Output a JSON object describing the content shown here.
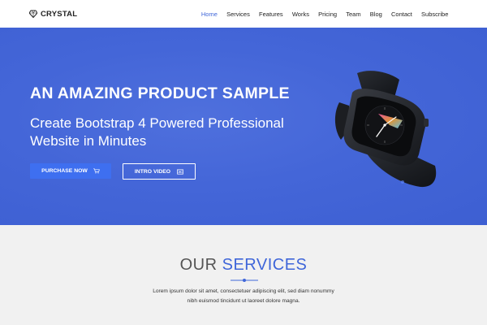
{
  "brand": {
    "name": "CRYSTAL",
    "icon": "diamond-icon"
  },
  "nav": {
    "items": [
      {
        "label": "Home",
        "active": true
      },
      {
        "label": "Services",
        "active": false
      },
      {
        "label": "Features",
        "active": false
      },
      {
        "label": "Works",
        "active": false
      },
      {
        "label": "Pricing",
        "active": false
      },
      {
        "label": "Team",
        "active": false
      },
      {
        "label": "Blog",
        "active": false
      },
      {
        "label": "Contact",
        "active": false
      },
      {
        "label": "Subscribe",
        "active": false
      }
    ]
  },
  "hero": {
    "title": "AN AMAZING PRODUCT SAMPLE",
    "subtitle": "Create Bootstrap 4 Powered Professional Website in Minutes",
    "purchase_label": "PURCHASE NOW",
    "purchase_icon": "cart-icon",
    "intro_label": "INTRO VIDEO",
    "intro_icon": "video-icon",
    "background_color": "#4466d8",
    "product_image": "smartwatch"
  },
  "services": {
    "title_plain": "OUR",
    "title_accent": "SERVICES",
    "text_line1": "Lorem ipsum dolor sit amet, consectetuer adipiscing elit, sed diam nonummy",
    "text_line2": "nibh euismod tincidunt ut laoreet dolore magna."
  },
  "colors": {
    "accent": "#3f66d9",
    "button": "#3e6ff0",
    "section_bg": "#f1f1f1"
  }
}
